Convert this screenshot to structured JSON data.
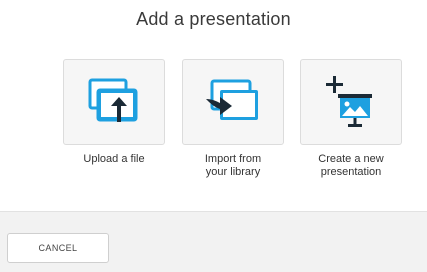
{
  "dialog": {
    "title": "Add a presentation"
  },
  "options": [
    {
      "label": "Upload a file",
      "icon": "upload-icon"
    },
    {
      "label": "Import from\nyour library",
      "icon": "import-icon"
    },
    {
      "label": "Create a new\npresentation",
      "icon": "create-presentation-icon"
    }
  ],
  "footer": {
    "cancel_label": "CANCEL"
  },
  "colors": {
    "accent_blue": "#1ea0e0",
    "accent_dark": "#1b2a36",
    "card_bg": "#f6f6f6",
    "footer_bg": "#f2f2f2"
  }
}
